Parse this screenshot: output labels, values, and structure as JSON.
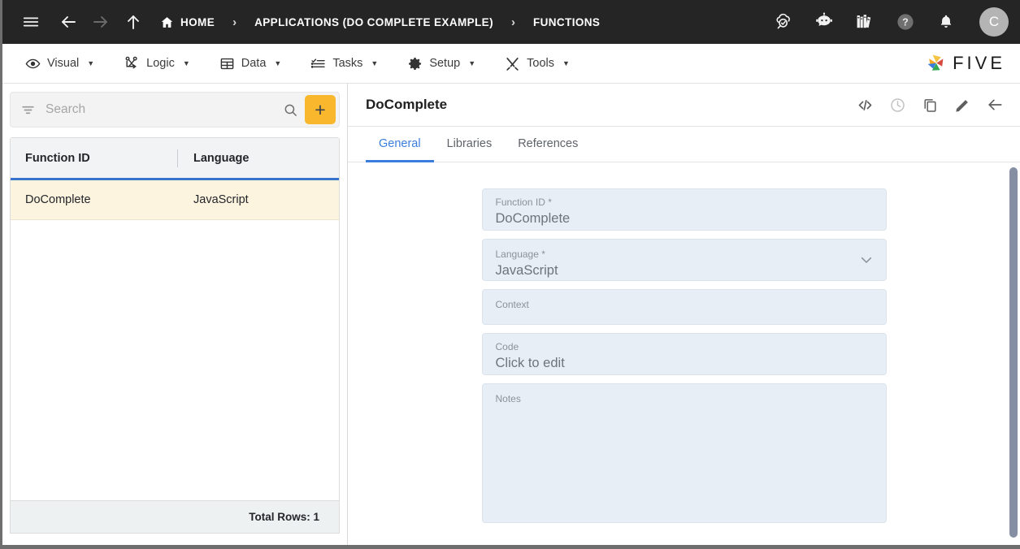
{
  "topbar": {
    "menu_icon": "hamburger-icon",
    "back_icon": "arrow-left-icon",
    "forward_icon": "arrow-right-icon",
    "up_icon": "arrow-up-icon",
    "breadcrumbs": [
      {
        "label": "HOME",
        "icon": "home-icon"
      },
      {
        "label": "APPLICATIONS (DO COMPLETE EXAMPLE)",
        "icon": ""
      },
      {
        "label": "FUNCTIONS",
        "icon": ""
      }
    ],
    "separator": "›",
    "actions": [
      {
        "name": "cloud-check-icon",
        "title": "Deploy"
      },
      {
        "name": "chat-bot-icon",
        "title": "Assistant"
      },
      {
        "name": "books-icon",
        "title": "Documentation"
      },
      {
        "name": "help-icon",
        "title": "Help"
      },
      {
        "name": "bell-icon",
        "title": "Notifications"
      }
    ],
    "avatar_initial": "C",
    "accent_color": "#f5c23a",
    "background_color": "#252525"
  },
  "menubar": {
    "items": [
      {
        "label": "Visual",
        "icon": "eye-icon"
      },
      {
        "label": "Logic",
        "icon": "logic-nodes-icon"
      },
      {
        "label": "Data",
        "icon": "table-grid-icon"
      },
      {
        "label": "Tasks",
        "icon": "task-list-icon"
      },
      {
        "label": "Setup",
        "icon": "gear-icon"
      },
      {
        "label": "Tools",
        "icon": "tools-icon"
      }
    ],
    "caret": "▼",
    "logo_text": "FIVE"
  },
  "list_panel": {
    "search": {
      "placeholder": "Search",
      "value": "",
      "filter_icon": "filter-icon",
      "search_icon": "magnifier-icon"
    },
    "add_button_label": "+",
    "add_button_color": "#f8b72c",
    "columns": [
      "Function ID",
      "Language"
    ],
    "rows": [
      {
        "function_id": "DoComplete",
        "language": "JavaScript",
        "selected": true
      }
    ],
    "footer_text": "Total Rows: 1",
    "selected_row_color": "#fdf4df",
    "header_underline_color": "#3874cb"
  },
  "detail_panel": {
    "title": "DoComplete",
    "actions": [
      {
        "name": "code-icon",
        "glyph": "</>"
      },
      {
        "name": "history-clock-icon",
        "glyph": "clock"
      },
      {
        "name": "duplicate-icon",
        "glyph": "copy"
      },
      {
        "name": "edit-pencil-icon",
        "glyph": "pencil"
      },
      {
        "name": "back-arrow-icon",
        "glyph": "arrow-left"
      }
    ],
    "tabs": [
      {
        "label": "General",
        "active": true
      },
      {
        "label": "Libraries",
        "active": false
      },
      {
        "label": "References",
        "active": false
      }
    ],
    "active_tab_color": "#3b7ddd",
    "fields": [
      {
        "label": "Function ID *",
        "value": "DoComplete",
        "type": "text"
      },
      {
        "label": "Language *",
        "value": "JavaScript",
        "type": "select"
      },
      {
        "label": "Context",
        "value": "",
        "type": "text"
      },
      {
        "label": "Code",
        "value": "Click to edit",
        "type": "text"
      },
      {
        "label": "Notes",
        "value": "",
        "type": "textarea"
      }
    ],
    "field_background": "#e8eef5"
  }
}
